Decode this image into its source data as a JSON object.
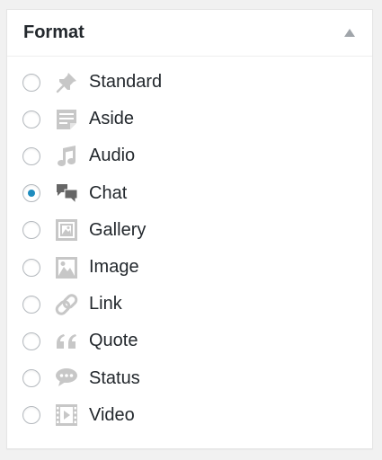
{
  "panel": {
    "title": "Format",
    "toggle_icon": "triangle-up-icon"
  },
  "colors": {
    "icon_default": "#c7c7c7",
    "icon_selected": "#666666",
    "radio_checked": "#1e8cbe"
  },
  "formats": [
    {
      "label": "Standard",
      "icon": "pin-icon",
      "checked": false
    },
    {
      "label": "Aside",
      "icon": "aside-icon",
      "checked": false
    },
    {
      "label": "Audio",
      "icon": "music-note-icon",
      "checked": false
    },
    {
      "label": "Chat",
      "icon": "chat-bubbles-icon",
      "checked": true
    },
    {
      "label": "Gallery",
      "icon": "gallery-icon",
      "checked": false
    },
    {
      "label": "Image",
      "icon": "image-icon",
      "checked": false
    },
    {
      "label": "Link",
      "icon": "link-icon",
      "checked": false
    },
    {
      "label": "Quote",
      "icon": "quote-icon",
      "checked": false
    },
    {
      "label": "Status",
      "icon": "status-bubble-icon",
      "checked": false
    },
    {
      "label": "Video",
      "icon": "video-icon",
      "checked": false
    }
  ]
}
